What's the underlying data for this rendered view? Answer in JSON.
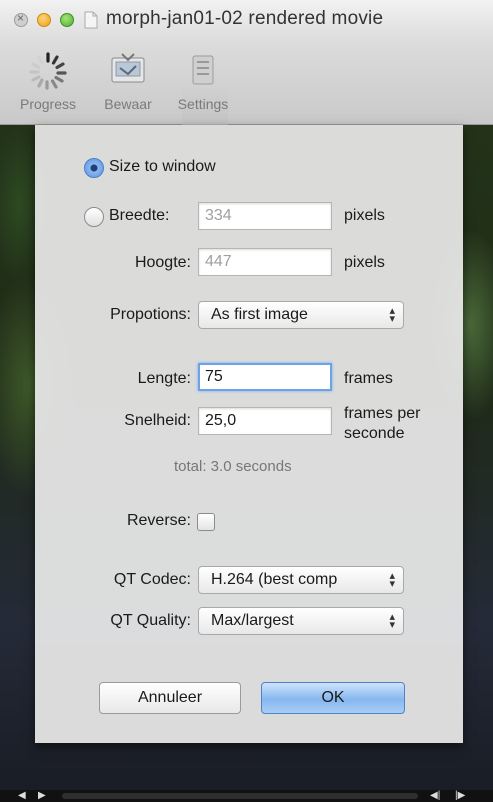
{
  "window": {
    "title": "morph-jan01-02 rendered movie"
  },
  "toolbar": {
    "items": [
      {
        "label": "Progress",
        "icon": "spinner-icon"
      },
      {
        "label": "Bewaar",
        "icon": "save-icon"
      },
      {
        "label": "Settings",
        "icon": "settings-icon"
      }
    ]
  },
  "form": {
    "size_to_window_label": "Size to window",
    "breedte_label": "Breedte:",
    "breedte_value": "334",
    "hoogte_label": "Hoogte:",
    "hoogte_value": "447",
    "pixels_unit": "pixels",
    "proportions_label": "Propotions:",
    "proportions_value": "As first image",
    "lengte_label": "Lengte:",
    "lengte_value": "75",
    "lengte_unit": "frames",
    "snelheid_label": "Snelheid:",
    "snelheid_value": "25,0",
    "snelheid_unit_line1": "frames per",
    "snelheid_unit_line2": "seconde",
    "total_text": "total: 3.0 seconds",
    "reverse_label": "Reverse:",
    "reverse_checked": false,
    "codec_label": "QT Codec:",
    "codec_value": "H.264 (best comp",
    "quality_label": "QT Quality:",
    "quality_value": "Max/largest"
  },
  "buttons": {
    "cancel": "Annuleer",
    "ok": "OK"
  },
  "colors": {
    "accent": "#6ea2e6",
    "ok_button": "#86b7ef"
  }
}
